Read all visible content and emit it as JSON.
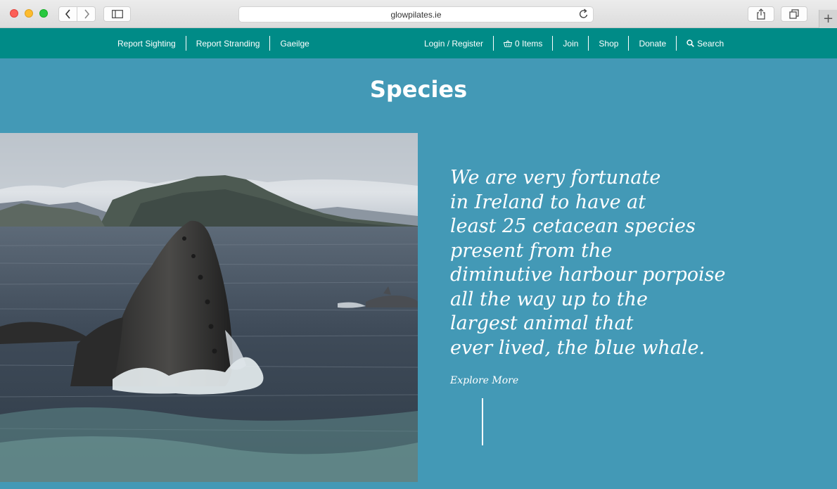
{
  "browser": {
    "url": "glowpilates.ie",
    "icons": [
      "chevron-left-icon",
      "chevron-right-icon",
      "sidebar-icon",
      "reload-icon",
      "share-icon",
      "tabs-icon",
      "plus-icon"
    ],
    "new_tab_glyph": "+"
  },
  "nav": {
    "left": [
      "Report Sighting",
      "Report Stranding",
      "Gaeilge"
    ],
    "login": "Login / Register",
    "cart": "0 Items",
    "join": "Join",
    "shop": "Shop",
    "donate": "Donate",
    "search": "Search"
  },
  "main": {
    "title": "Species",
    "intro_lines": [
      "We are very fortunate",
      "in Ireland to have at",
      "least 25 cetacean species",
      "present from the",
      "diminutive harbour porpoise",
      "all the way up to the",
      "largest animal that",
      "ever lived, the blue whale."
    ],
    "explore_label": "Explore More"
  },
  "colors": {
    "nav_bg": "#008b87",
    "page_bg": "#4399b6",
    "text": "#ffffff"
  }
}
